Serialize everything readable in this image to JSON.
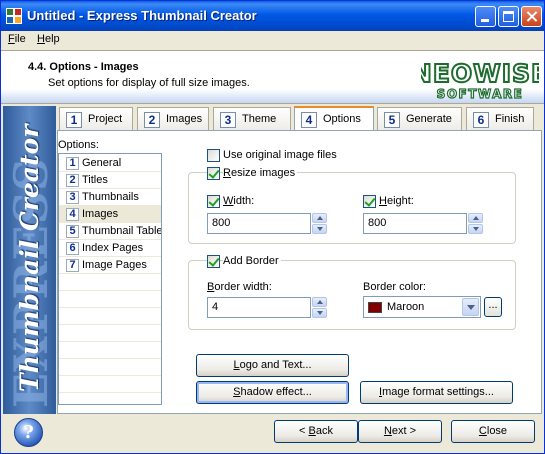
{
  "window": {
    "title": "Untitled - Express Thumbnail Creator"
  },
  "menu": [
    {
      "label": "File",
      "key": "F",
      "rest": "ile"
    },
    {
      "label": "Help",
      "key": "H",
      "rest": "elp"
    }
  ],
  "header": {
    "title": "4.4. Options - Images",
    "subtitle": "Set options for display of full size images.",
    "logo": {
      "line1": "NEOWISE",
      "line2": "SOFTWARE"
    }
  },
  "banner": {
    "express": "EXPRESS",
    "product": "Thumbnail Creator"
  },
  "tabs": [
    {
      "num": "1",
      "label": "Project"
    },
    {
      "num": "2",
      "label": "Images"
    },
    {
      "num": "3",
      "label": "Theme"
    },
    {
      "num": "4",
      "label": "Options",
      "active": true
    },
    {
      "num": "5",
      "label": "Generate"
    },
    {
      "num": "6",
      "label": "Finish"
    }
  ],
  "options": {
    "caption": "Options:",
    "items": [
      {
        "num": "1",
        "label": "General"
      },
      {
        "num": "2",
        "label": "Titles"
      },
      {
        "num": "3",
        "label": "Thumbnails"
      },
      {
        "num": "4",
        "label": "Images",
        "selected": true
      },
      {
        "num": "5",
        "label": "Thumbnail Table"
      },
      {
        "num": "6",
        "label": "Index Pages"
      },
      {
        "num": "7",
        "label": "Image Pages"
      }
    ]
  },
  "images": {
    "use_original": {
      "label": "Use original image files",
      "checked": false
    },
    "resize": {
      "key": "R",
      "rest": "esize images",
      "checked": true
    },
    "width": {
      "key": "W",
      "rest": "idth:",
      "value": "800",
      "checked": true
    },
    "height": {
      "key": "H",
      "rest": "eight:",
      "value": "800",
      "checked": true
    },
    "add_border": {
      "label": "Add Border",
      "checked": true
    },
    "border_width": {
      "key": "B",
      "rest": "order width:",
      "value": "4"
    },
    "border_color": {
      "label": "Border color:",
      "value": "Maroon",
      "color": "#800000",
      "browse": "..."
    }
  },
  "actions": {
    "logo_text": {
      "key": "L",
      "rest": "ogo and Text..."
    },
    "shadow": {
      "key": "S",
      "rest": "hadow effect..."
    },
    "image_format": {
      "key": "I",
      "rest": "mage format settings..."
    }
  },
  "footer": {
    "help": "?",
    "back": {
      "pre": "< ",
      "key": "B",
      "rest": "ack"
    },
    "next": {
      "pre": "",
      "key": "N",
      "rest": "ext >"
    },
    "close": {
      "pre": "",
      "key": "C",
      "rest": "lose"
    }
  }
}
